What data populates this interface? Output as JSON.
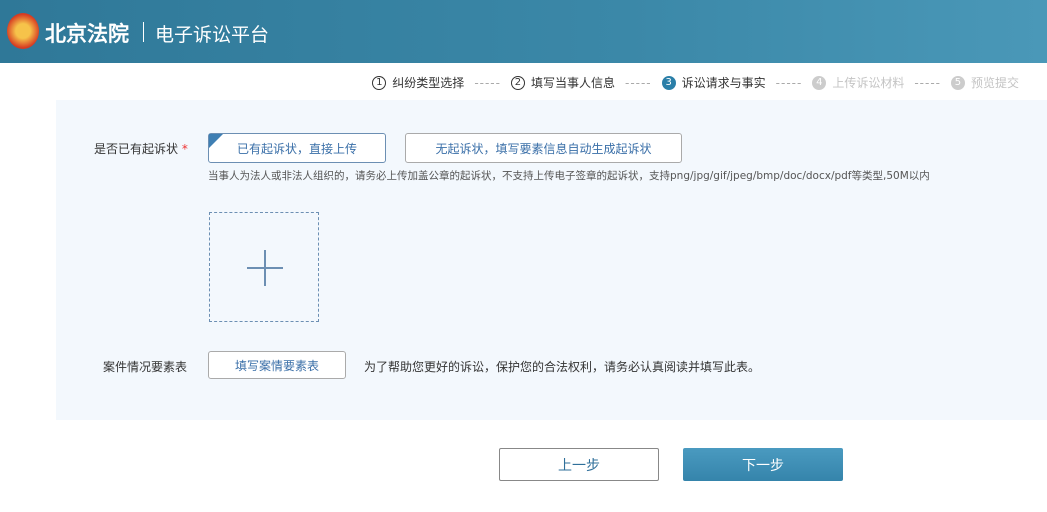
{
  "header": {
    "brand": "北京法院",
    "subtitle": "电子诉讼平台"
  },
  "steps": [
    {
      "num": "1",
      "label": "纠纷类型选择",
      "state": "done"
    },
    {
      "num": "2",
      "label": "填写当事人信息",
      "state": "done"
    },
    {
      "num": "3",
      "label": "诉讼请求与事实",
      "state": "active"
    },
    {
      "num": "4",
      "label": "上传诉讼材料",
      "state": "off"
    },
    {
      "num": "5",
      "label": "预览提交",
      "state": "off"
    }
  ],
  "step_sep": "-----",
  "form": {
    "complaint_label": "是否已有起诉状",
    "required_mark": "*",
    "option_have": "已有起诉状，直接上传",
    "option_none": "无起诉状，填写要素信息自动生成起诉状",
    "hint": "当事人为法人或非法人组织的，请务必上传加盖公章的起诉状，不支持上传电子签章的起诉状，支持png/jpg/gif/jpeg/bmp/doc/docx/pdf等类型,50M以内",
    "elements_label": "案件情况要素表",
    "elements_button": "填写案情要素表",
    "elements_note": "为了帮助您更好的诉讼，保护您的合法权利，请务必认真阅读并填写此表。"
  },
  "nav": {
    "prev": "上一步",
    "next": "下一步"
  }
}
